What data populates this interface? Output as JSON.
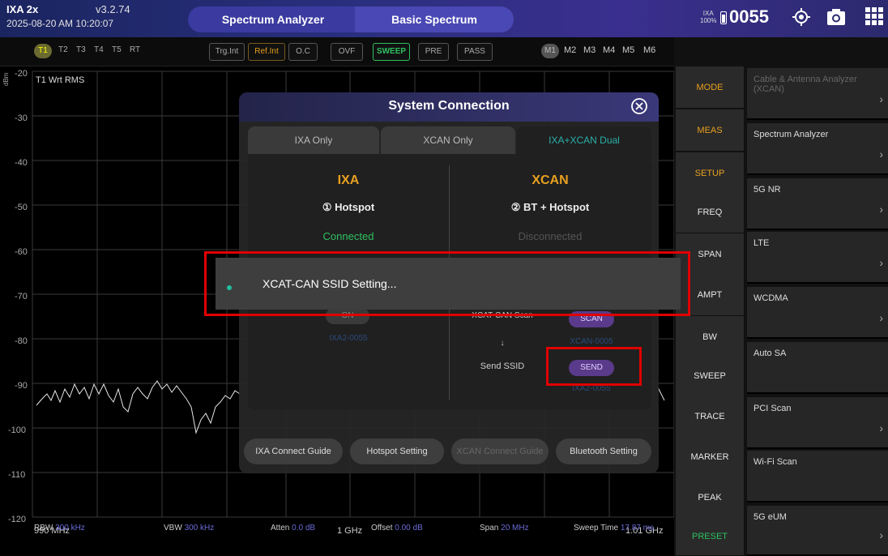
{
  "header": {
    "model": "IXA 2x",
    "version": "v3.2.74",
    "datetime": "2025-08-20 AM 10:20:07",
    "breadcrumb": [
      "Spectrum Analyzer",
      "Basic Spectrum"
    ],
    "battery_label_top": "IXA",
    "battery_label_bottom": "100%",
    "serial": "0055"
  },
  "traces": [
    "T1",
    "T2",
    "T3",
    "T4",
    "T5",
    "RT"
  ],
  "indicators": [
    "Trg.Int",
    "Ref.Int",
    "O.C",
    "OVF",
    "SWEEP",
    "PRE",
    "PASS"
  ],
  "markers": [
    "M1",
    "M2",
    "M3",
    "M4",
    "M5",
    "M6"
  ],
  "plot": {
    "unit": "dBm",
    "trace_label": "T1 Wrt RMS",
    "y_ticks": [
      "-20",
      "-30",
      "-40",
      "-50",
      "-60",
      "-70",
      "-80",
      "-90",
      "-100",
      "-110",
      "-120"
    ],
    "x_left": "990 MHz",
    "x_center": "1 GHz",
    "x_right": "1.01 GHz"
  },
  "readouts": {
    "rbw_label": "RBW",
    "rbw": "300 kHz",
    "vbw_label": "VBW",
    "vbw": "300 kHz",
    "atten_label": "Atten",
    "atten": "0.0 dB",
    "offset_label": "Offset",
    "offset": "0.00 dB",
    "span_label": "Span",
    "span": "20 MHz",
    "sweep_label": "Sweep Time",
    "sweep": "17.87 ms"
  },
  "menu": [
    "MODE",
    "MEAS",
    "SETUP",
    "FREQ",
    "SPAN",
    "AMPT",
    "BW",
    "SWEEP",
    "TRACE",
    "MARKER",
    "PEAK",
    "PRESET"
  ],
  "submenu": [
    "Cable & Antenna Analyzer (XCAN)",
    "Spectrum Analyzer",
    "5G NR",
    "LTE",
    "WCDMA",
    "Auto SA",
    "PCI Scan",
    "Wi-Fi Scan",
    "5G eUM"
  ],
  "dialog": {
    "title": "System Connection",
    "tabs": [
      "IXA Only",
      "XCAN Only",
      "IXA+XCAN Dual"
    ],
    "ixa": {
      "title": "IXA",
      "step": "① Hotspot",
      "status": "Connected",
      "toggle": "ON",
      "ssid": "IXA2-0055"
    },
    "xcan": {
      "title": "XCAN",
      "step": "② BT + Hotspot",
      "status": "Disconnected",
      "scan_label": "XCAT-CAN Scan",
      "scan_btn": "SCAN",
      "device": "XCAN-0005",
      "arrow": "↓",
      "send_label": "Send SSID",
      "send_btn": "SEND",
      "ssid": "IXA2-0055"
    },
    "footer": [
      "IXA Connect Guide",
      "Hotspot Setting",
      "XCAN Connect Guide",
      "Bluetooth Setting"
    ]
  },
  "toast": {
    "message": "XCAT-CAN SSID Setting..."
  },
  "colors": {
    "accent_orange": "#e8a020",
    "connected": "#2ec060",
    "toolbar_purple": "#3b3aa0",
    "highlight_red": "#e00000"
  }
}
